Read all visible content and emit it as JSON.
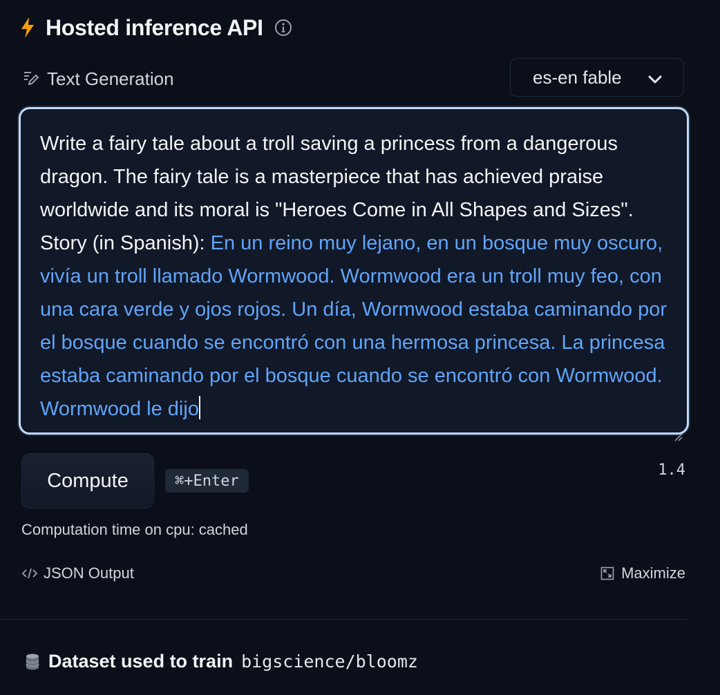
{
  "header": {
    "title": "Hosted inference API",
    "accent_color": "#f59e0b"
  },
  "task": {
    "label": "Text Generation"
  },
  "example_select": {
    "selected": "es-en fable"
  },
  "textarea": {
    "prompt": "Write a fairy tale about a troll saving a princess from a dangerous dragon. The fairy tale is a masterpiece that has achieved praise worldwide and its moral is \"Heroes Come in All Shapes and Sizes\". Story (in Spanish): ",
    "generated": "En un reino muy lejano, en un bosque muy oscuro, vivía un troll llamado Wormwood. Wormwood era un troll muy feo, con una cara verde y ojos rojos. Un día, Wormwood estaba caminando por el bosque cuando se encontró con una hermosa princesa. La princesa estaba caminando por el bosque cuando se encontró con Wormwood. Wormwood le dijo",
    "generated_color": "#60a5fa",
    "border_color": "#bfdbfe"
  },
  "actions": {
    "compute_label": "Compute",
    "shortcut": "⌘+Enter",
    "value": "1.4"
  },
  "status": {
    "computation_time": "Computation time on cpu: cached"
  },
  "footer_links": {
    "json_output": "JSON Output",
    "maximize": "Maximize"
  },
  "dataset": {
    "label": "Dataset used to train",
    "name": "bigscience/bloomz"
  },
  "icons": {
    "header": "lightning-icon",
    "info": "info-icon",
    "task": "text-generation-icon",
    "select": "chevron-down-icon",
    "json": "code-icon",
    "maximize": "maximize-icon",
    "dataset": "database-icon"
  }
}
